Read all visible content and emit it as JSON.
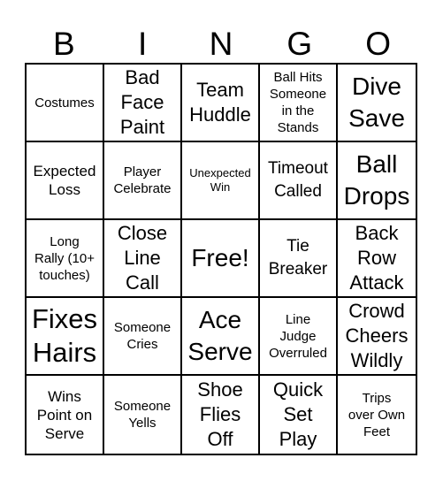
{
  "header": {
    "letters": [
      "B",
      "I",
      "N",
      "G",
      "O"
    ]
  },
  "board": {
    "rows": [
      [
        {
          "text": "Costumes",
          "size": "s"
        },
        {
          "text": "Bad\nFace\nPaint",
          "size": "xl"
        },
        {
          "text": "Team\nHuddle",
          "size": "xl"
        },
        {
          "text": "Ball Hits\nSomeone\nin the\nStands",
          "size": "s"
        },
        {
          "text": "Dive\nSave",
          "size": "xxl"
        }
      ],
      [
        {
          "text": "Expected\nLoss",
          "size": "m"
        },
        {
          "text": "Player\nCelebrate",
          "size": "s"
        },
        {
          "text": "Unexpected\nWin",
          "size": "xs"
        },
        {
          "text": "Timeout\nCalled",
          "size": "l"
        },
        {
          "text": "Ball\nDrops",
          "size": "xxl"
        }
      ],
      [
        {
          "text": "Long\nRally (10+\ntouches)",
          "size": "s"
        },
        {
          "text": "Close\nLine\nCall",
          "size": "xl"
        },
        {
          "text": "Free!",
          "size": "xxl"
        },
        {
          "text": "Tie\nBreaker",
          "size": "l"
        },
        {
          "text": "Back\nRow\nAttack",
          "size": "xl"
        }
      ],
      [
        {
          "text": "Fixes\nHairs",
          "size": "xxxl"
        },
        {
          "text": "Someone\nCries",
          "size": "s"
        },
        {
          "text": "Ace\nServe",
          "size": "xxl"
        },
        {
          "text": "Line\nJudge\nOverruled",
          "size": "s"
        },
        {
          "text": "Crowd\nCheers\nWildly",
          "size": "xl"
        }
      ],
      [
        {
          "text": "Wins\nPoint on\nServe",
          "size": "m"
        },
        {
          "text": "Someone\nYells",
          "size": "s"
        },
        {
          "text": "Shoe\nFlies\nOff",
          "size": "xl"
        },
        {
          "text": "Quick\nSet\nPlay",
          "size": "xl"
        },
        {
          "text": "Trips\nover Own\nFeet",
          "size": "s"
        }
      ]
    ]
  },
  "colors": {
    "line": "#000000",
    "background": "#ffffff",
    "text": "#000000"
  }
}
